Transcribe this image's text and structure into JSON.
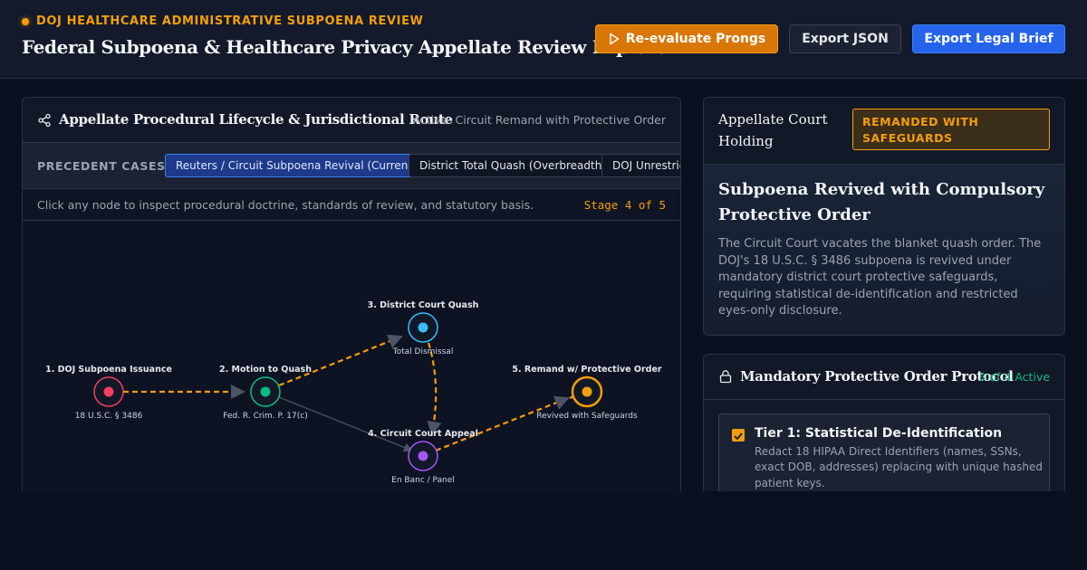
{
  "header": {
    "eyebrow": "DOJ HEALTHCARE ADMINISTRATIVE SUBPOENA REVIEW",
    "title": "Federal Subpoena & Healthcare Privacy Appellate Review Explorer",
    "buttons": {
      "reevaluate": "Re-evaluate Prongs",
      "export_json": "Export JSON",
      "export_brief": "Export Legal Brief"
    }
  },
  "lifecycle": {
    "title": "Appellate Procedural Lifecycle & Jurisdictional Route",
    "active": "Active: Circuit Remand with Protective Order",
    "cases_label": "PRECEDENT CASES:",
    "cases": [
      "Reuters / Circuit Subpoena Revival (Current)",
      "District Total Quash (Overbreadth)",
      "DOJ Unrestricted"
    ],
    "hint": "Click any node to inspect procedural doctrine, standards of review, and statutory basis.",
    "stage": "Stage 4 of 5",
    "nodes": [
      {
        "label": "1. DOJ Subpoena Issuance",
        "sub": "18 U.S.C. § 3486",
        "color": "#f43f5e"
      },
      {
        "label": "2. Motion to Quash",
        "sub": "Fed. R. Crim. P. 17(c)",
        "color": "#10b981"
      },
      {
        "label": "3. District Court Quash",
        "sub": "Total Dismissal",
        "color": "#38bdf8"
      },
      {
        "label": "4. Circuit Court Appeal",
        "sub": "En Banc / Panel",
        "color": "#a855f7"
      },
      {
        "label": "5. Remand w/ Protective Order",
        "sub": "Revived with Safeguards",
        "color": "#f59e0b"
      }
    ]
  },
  "holding": {
    "title": "Appellate Court Holding",
    "badge": "REMANDED WITH SAFEGUARDS",
    "heading": "Subpoena Revived with Compulsory Protective Order",
    "text": "The Circuit Court vacates the blanket quash order. The DOJ's 18 U.S.C. § 3486 subpoena is revived under mandatory district court protective safeguards, requiring statistical de-identification and restricted eyes-only disclosure."
  },
  "protocol": {
    "title": "Mandatory Protective Order Protocol",
    "count": "3 of 4 Active",
    "tiers": [
      {
        "title": "Tier 1: Statistical De-Identification",
        "text": "Redact 18 HIPAA Direct Identifiers (names, SSNs, exact DOB, addresses) replacing with unique hashed patient keys.",
        "checked": true
      }
    ]
  },
  "colors": {
    "accent": "#f59e0b",
    "primary": "#2563eb",
    "background": "#0b1020"
  }
}
